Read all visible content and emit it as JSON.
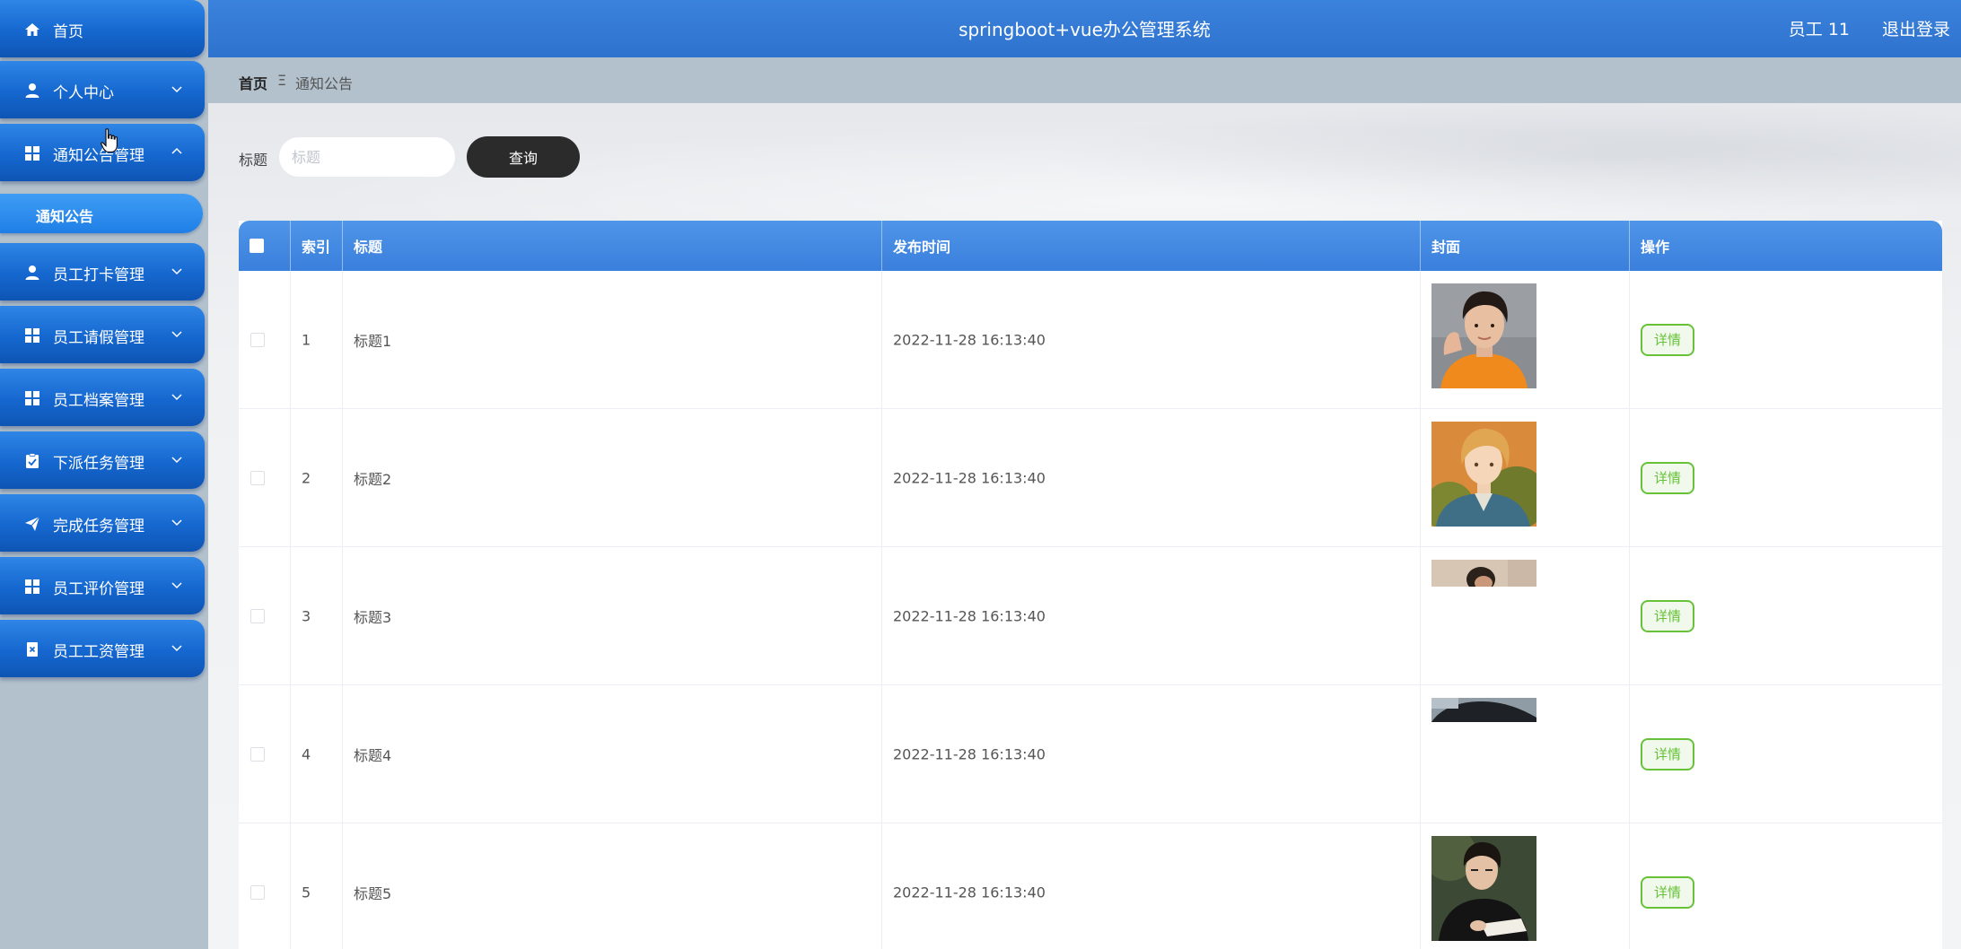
{
  "header": {
    "title": "springboot+vue办公管理系统",
    "user": "员工 11",
    "logout": "退出登录"
  },
  "sidebar": {
    "items": [
      {
        "label": "首页",
        "icon": "home-icon"
      },
      {
        "label": "个人中心",
        "icon": "user-icon"
      },
      {
        "label": "通知公告管理",
        "icon": "grid-icon"
      },
      {
        "label": "员工打卡管理",
        "icon": "user-icon"
      },
      {
        "label": "员工请假管理",
        "icon": "grid-icon"
      },
      {
        "label": "员工档案管理",
        "icon": "grid-icon"
      },
      {
        "label": "下派任务管理",
        "icon": "clipboard-check-icon"
      },
      {
        "label": "完成任务管理",
        "icon": "paper-plane-icon"
      },
      {
        "label": "员工评价管理",
        "icon": "grid-icon"
      },
      {
        "label": "员工工资管理",
        "icon": "document-x-icon"
      }
    ],
    "sub_item": "通知公告",
    "active": "通知公告管理"
  },
  "breadcrumb": {
    "home": "首页",
    "separator": "Ξ",
    "current": "通知公告"
  },
  "search": {
    "label": "标题",
    "placeholder": "标题",
    "value": "",
    "button": "查询"
  },
  "table": {
    "columns": [
      "索引",
      "标题",
      "发布时间",
      "封面",
      "操作"
    ],
    "rows": [
      {
        "index": "1",
        "title": "标题1",
        "time": "2022-11-28 16:13:40",
        "action": "详情"
      },
      {
        "index": "2",
        "title": "标题2",
        "time": "2022-11-28 16:13:40",
        "action": "详情"
      },
      {
        "index": "3",
        "title": "标题3",
        "time": "2022-11-28 16:13:40",
        "action": "详情"
      },
      {
        "index": "4",
        "title": "标题4",
        "time": "2022-11-28 16:13:40",
        "action": "详情"
      },
      {
        "index": "5",
        "title": "标题5",
        "time": "2022-11-28 16:13:40",
        "action": "详情"
      }
    ]
  },
  "colors": {
    "accent": "#2e73cd",
    "menu": "#1567cf",
    "success": "#67c23a",
    "search_button": "#2b2b2b"
  }
}
